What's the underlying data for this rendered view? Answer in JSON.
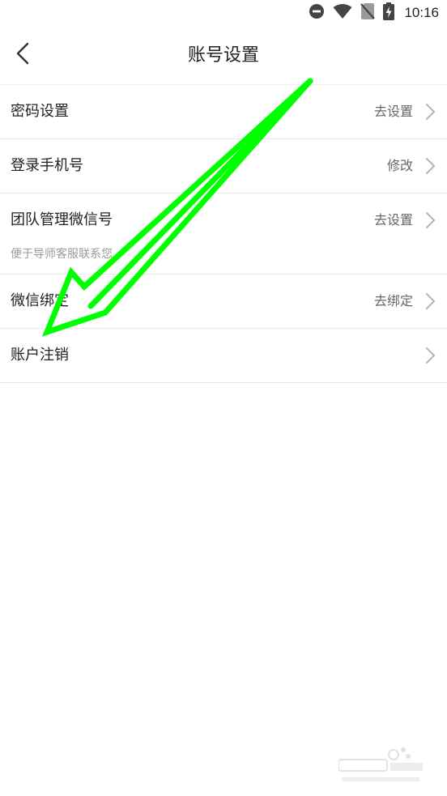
{
  "status_bar": {
    "time": "10:16",
    "icons": [
      "do-not-disturb-icon",
      "wifi-icon",
      "no-sim-icon",
      "battery-charging-icon"
    ]
  },
  "header": {
    "title": "账号设置",
    "back_icon": "chevron-left-icon"
  },
  "settings": {
    "items": [
      {
        "label": "密码设置",
        "action": "去设置",
        "icon": "chevron-right-icon"
      },
      {
        "label": "登录手机号",
        "action": "修改",
        "icon": "chevron-right-icon"
      },
      {
        "label": "团队管理微信号",
        "action": "去设置",
        "subtext": "便于导师客服联系您",
        "icon": "chevron-right-icon"
      },
      {
        "label": "微信绑定",
        "action": "去绑定",
        "icon": "chevron-right-icon"
      },
      {
        "label": "账户注销",
        "action": "",
        "icon": "chevron-right-icon"
      }
    ]
  },
  "annotation": {
    "color": "#00ff00",
    "icon": "arrow-annotation-icon"
  },
  "colors": {
    "background": "#ffffff",
    "text_primary": "#222222",
    "text_secondary": "#666666",
    "divider": "#e9e9e9"
  }
}
